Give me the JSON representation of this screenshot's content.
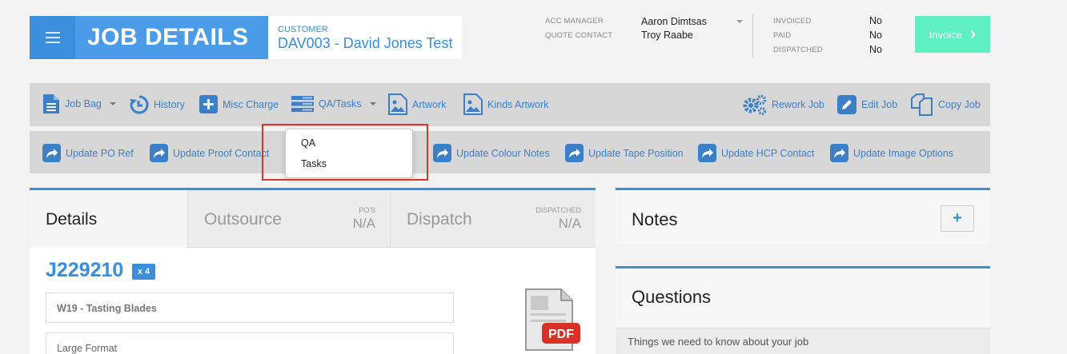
{
  "header": {
    "title": "JOB DETAILS",
    "customer_label": "CUSTOMER",
    "customer_value": "DAV003 - David Jones Test",
    "acc_manager_label": "ACC MANAGER",
    "acc_manager_value": "Aaron Dimtsas",
    "quote_contact_label": "QUOTE CONTACT",
    "quote_contact_value": "Troy Raabe",
    "invoiced_label": "INVOICED",
    "invoiced_value": "No",
    "paid_label": "PAID",
    "paid_value": "No",
    "dispatched_label": "DISPATCHED",
    "dispatched_value": "No",
    "invoice_button": "Invoice"
  },
  "toolbar1": {
    "job_bag": "Job Bag",
    "history": "History",
    "misc_charge": "Misc Charge",
    "qa_tasks": "QA/Tasks",
    "artwork": "Artwork",
    "kinds_artwork": "Kinds Artwork",
    "rework_job": "Rework Job",
    "edit_job": "Edit Job",
    "copy_job": "Copy Job"
  },
  "toolbar2": {
    "update_po_ref": "Update PO Ref",
    "update_proof_contact": "Update Proof Contact",
    "update_colour_notes": "Update Colour Notes",
    "update_tape_position": "Update Tape Position",
    "update_hcp_contact": "Update HCP Contact",
    "update_image_options": "Update Image Options"
  },
  "qa_dropdown": {
    "items": [
      "QA",
      "Tasks"
    ]
  },
  "details": {
    "tabs": {
      "details": "Details",
      "outsource": "Outsource",
      "outsource_sub_label": "PO'S",
      "outsource_sub_value": "N/A",
      "dispatch": "Dispatch",
      "dispatch_sub_label": "DISPATCHED",
      "dispatch_sub_value": "N/A"
    },
    "job_number": "J229210",
    "quantity_badge": "x 4",
    "job_name": "W19 - Tasting Blades",
    "format": "Large Format",
    "pdf_label": "PDF"
  },
  "notes": {
    "title": "Notes",
    "add_button": "+"
  },
  "questions": {
    "title": "Questions",
    "subtitle": "Things we need to know about your job"
  },
  "colors": {
    "accent": "#3a8edb",
    "invoice_button": "#5ff0c2",
    "highlight": "#e0322e",
    "pdf_red": "#d9302a"
  }
}
